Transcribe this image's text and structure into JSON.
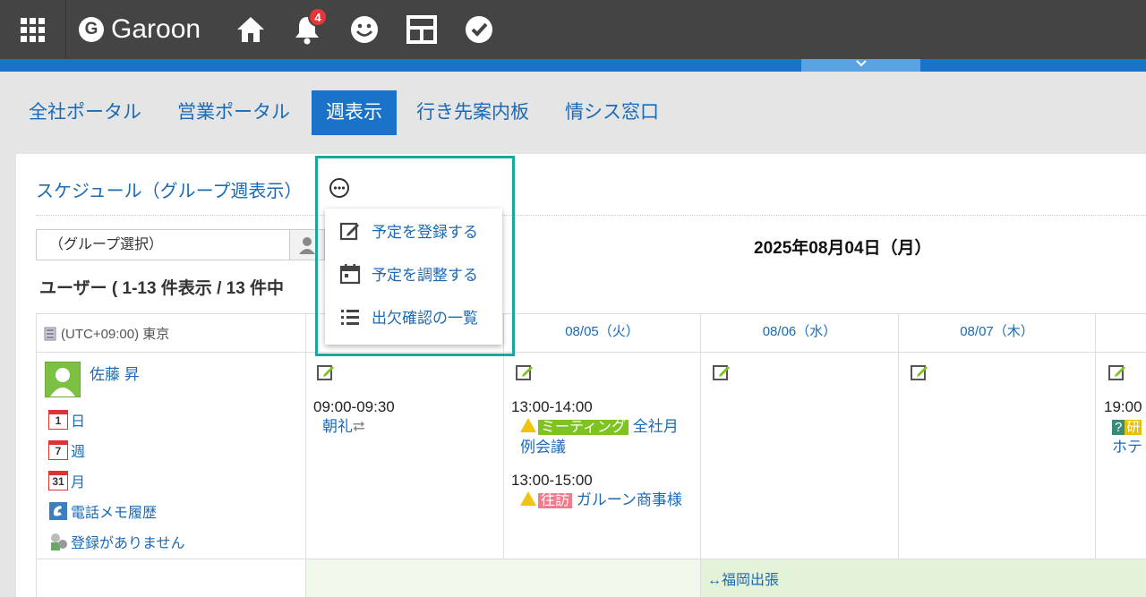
{
  "header": {
    "brand": "Garoon",
    "brand_letter": "G",
    "notification_count": "4",
    "expand_icon": "chevron-down-icon"
  },
  "tabs": [
    {
      "label": "全社ポータル"
    },
    {
      "label": "営業ポータル"
    },
    {
      "label": "週表示"
    },
    {
      "label": "行き先案内板"
    },
    {
      "label": "情シス窓口"
    }
  ],
  "schedule": {
    "title": "スケジュール（グループ週表示）",
    "group_select": "（グループ選択）",
    "date_title": "2025年08月04日（月）",
    "user_count": "ユーザー ( 1-13 件表示 / 13 件中"
  },
  "menu": {
    "items": [
      {
        "label": "予定を登録する",
        "icon": "edit-icon"
      },
      {
        "label": "予定を調整する",
        "icon": "calendar-icon"
      },
      {
        "label": "出欠確認の一覧",
        "icon": "list-icon"
      }
    ]
  },
  "grid": {
    "timezone": "(UTC+09:00) 東京",
    "days": [
      "08/05（火）",
      "08/06（水）",
      "08/07（木）"
    ],
    "user": {
      "name": "佐藤 昇",
      "links": [
        "日",
        "週",
        "月",
        "電話メモ履歴",
        "登録がありません"
      ],
      "cal_numbers": [
        "1",
        "7",
        "31"
      ]
    },
    "events": {
      "mon_time": "09:00-09:30",
      "mon_title": "朝礼",
      "tue_time1": "13:00-14:00",
      "tue_tag1": "ミーティング",
      "tue_title1a": "全社月",
      "tue_title1b": "例会議",
      "tue_time2": "13:00-15:00",
      "tue_tag2": "往訪",
      "tue_title2": "ガルーン商事様",
      "fri_time": "19:00",
      "fri_tag_q": "?",
      "fri_tag_y": "研",
      "fri_title": "ホテ"
    },
    "allday": {
      "trip_arrow": "↔",
      "trip": "福岡出張"
    }
  },
  "colors": {
    "topbar": "#444444",
    "accent": "#1a73c8",
    "link": "#1a6ab6",
    "highlight": "#1aa89c"
  }
}
